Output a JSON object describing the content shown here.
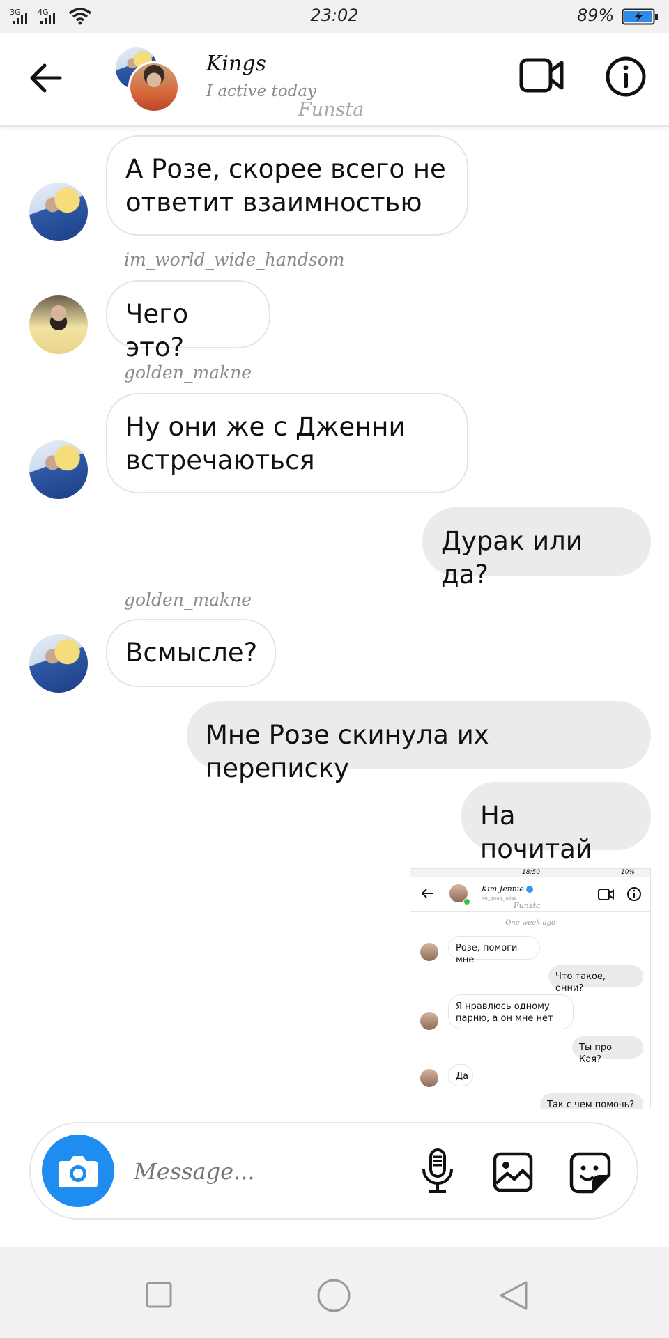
{
  "status_bar": {
    "network_1": "3G",
    "network_2": "4G",
    "time": "23:02",
    "battery": "89%"
  },
  "header": {
    "title": "Kings",
    "subtitle": "I active today",
    "watermark": "Funsta",
    "icons": [
      "back-arrow-icon",
      "video-call-icon",
      "info-icon"
    ]
  },
  "messages": [
    {
      "direction": "in",
      "sender": "",
      "text": "А Розе, скорее всего не ответит взаимностью"
    },
    {
      "direction": "in",
      "sender": "im_world_wide_handsom",
      "text": "Чего это?"
    },
    {
      "direction": "in",
      "sender": "golden_makne",
      "text": "Ну они же с Дженни встречаються"
    },
    {
      "direction": "out",
      "text": "Дурак или да?"
    },
    {
      "direction": "in",
      "sender": "golden_makne",
      "text": "Всмысле?"
    },
    {
      "direction": "out",
      "text": "Мне Розе скинула их переписку"
    },
    {
      "direction": "out",
      "text": "На почитай"
    }
  ],
  "shared_screenshot": {
    "status_time": "18:50",
    "status_battery": "10%",
    "title": "Kim Jennie",
    "subtitle": "im_bnus_lalisa",
    "watermark": "Funsta",
    "separator": "One week ago",
    "messages": [
      {
        "direction": "in",
        "text": "Розе, помоги мне"
      },
      {
        "direction": "out",
        "text": "Что такое, онни?"
      },
      {
        "direction": "in",
        "text": "Я нравлюсь одному парню, а он мне нет"
      },
      {
        "direction": "out",
        "text": "Ты про Кая?"
      },
      {
        "direction": "in",
        "text": "Да"
      },
      {
        "direction": "out",
        "text": "Так с чем помочь?"
      }
    ]
  },
  "composer": {
    "placeholder": "Message...",
    "icons": [
      "camera-icon",
      "microphone-icon",
      "gallery-icon",
      "sticker-icon"
    ]
  },
  "navigation_bar": {
    "buttons": [
      "recent-apps-button",
      "home-button",
      "back-button"
    ]
  },
  "colors": {
    "accent_blue": "#1f8cf0",
    "bubble_out": "#ebebed",
    "system_bar": "#f1f1f2"
  }
}
